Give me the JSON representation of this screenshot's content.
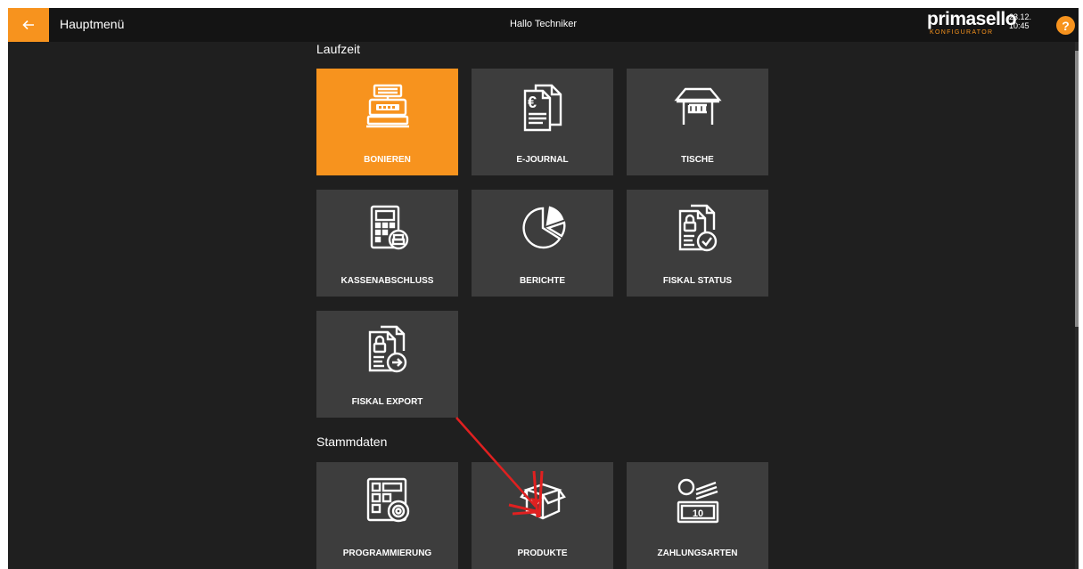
{
  "header": {
    "title": "Hauptmenü",
    "greeting": "Hallo Techniker",
    "logo_main": "primasello",
    "logo_sub": "KONFIGURATOR",
    "date": "23.12.",
    "time": "10:45",
    "help": "?"
  },
  "sections": {
    "runtime": {
      "title": "Laufzeit",
      "tiles": [
        {
          "label": "BONIEREN",
          "icon": "cash-register-icon",
          "active": true
        },
        {
          "label": "E-JOURNAL",
          "icon": "euro-document-icon"
        },
        {
          "label": "TISCHE",
          "icon": "table-icon"
        },
        {
          "label": "KASSENABSCHLUSS",
          "icon": "calculator-printer-icon"
        },
        {
          "label": "BERICHTE",
          "icon": "pie-chart-icon"
        },
        {
          "label": "FISKAL STATUS",
          "icon": "document-lock-check-icon"
        },
        {
          "label": "FISKAL EXPORT",
          "icon": "document-lock-export-icon"
        }
      ]
    },
    "master_data": {
      "title": "Stammdaten",
      "tiles": [
        {
          "label": "PROGRAMMIERUNG",
          "icon": "layout-gear-icon"
        },
        {
          "label": "PRODUKTE",
          "icon": "box-icon"
        },
        {
          "label": "ZAHLUNGSARTEN",
          "icon": "coin-banknote-icon",
          "banknote_value": "10"
        }
      ]
    }
  },
  "colors": {
    "accent": "#f7931e",
    "background": "#1f1f1f",
    "header": "#141414",
    "tile": "#3d3d3d",
    "annotation": "#e02020"
  }
}
